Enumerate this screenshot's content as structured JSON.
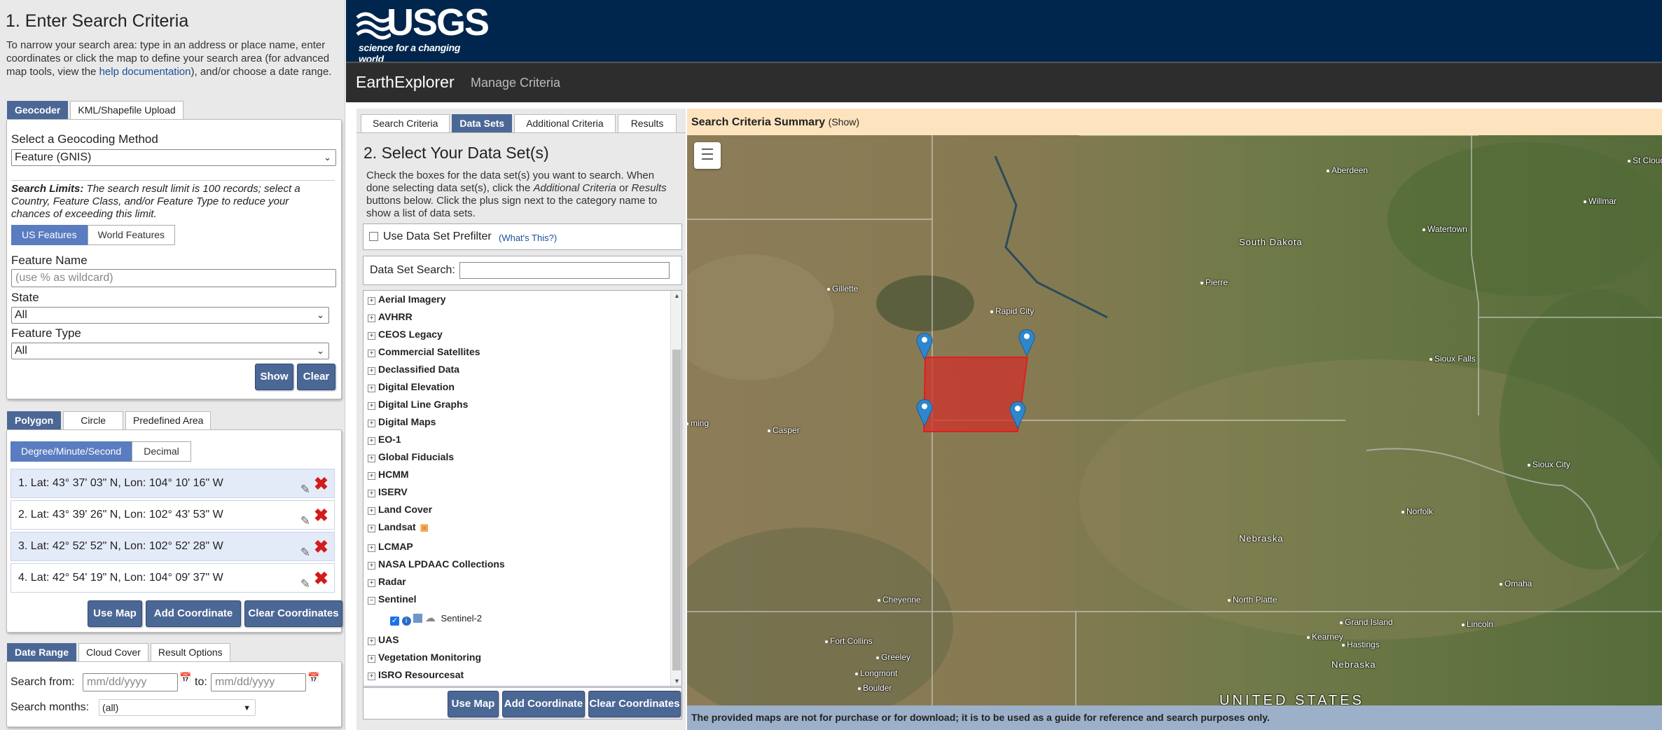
{
  "left": {
    "title": "1. Enter Search Criteria",
    "intro_pre": "To narrow your search area: type in an address or place name, enter coordinates or click the map to define your search area (for advanced map tools, view the ",
    "intro_link": "help documentation",
    "intro_post": "), and/or choose a date range.",
    "tabs": [
      "Geocoder",
      "KML/Shapefile Upload"
    ],
    "geocode_label": "Select a Geocoding Method",
    "geocode_value": "Feature (GNIS)",
    "limits_bold": "Search Limits:",
    "limits_text": " The search result limit is 100 records; select a Country, Feature Class, and/or Feature Type to reduce your chances of exceeding this limit.",
    "feature_toggle": [
      "US Features",
      "World Features"
    ],
    "feature_name_label": "Feature Name",
    "feature_name_placeholder": "(use % as wildcard)",
    "state_label": "State",
    "state_value": "All",
    "feature_type_label": "Feature Type",
    "feature_type_value": "All",
    "show_btn": "Show",
    "clear_btn": "Clear",
    "area_tabs": [
      "Polygon",
      "Circle",
      "Predefined Area"
    ],
    "format_toggle": [
      "Degree/Minute/Second",
      "Decimal"
    ],
    "coordinates": [
      "1.  Lat: 43° 37' 03\" N, Lon: 104° 10' 16\" W",
      "2.  Lat: 43° 39' 26\" N, Lon: 102° 43' 53\" W",
      "3.  Lat: 42° 52' 52\" N, Lon: 102° 52' 28\" W",
      "4.  Lat: 42° 54' 19\" N, Lon: 104° 09' 37\" W"
    ],
    "use_map_btn": "Use Map",
    "add_coord_btn": "Add Coordinate",
    "clear_coords_btn": "Clear Coordinates",
    "date_tabs": [
      "Date Range",
      "Cloud Cover",
      "Result Options"
    ],
    "search_from_label": "Search from:",
    "to_label": "to:",
    "date_placeholder": "mm/dd/yyyy",
    "months_label": "Search months:",
    "months_value": "(all)"
  },
  "header": {
    "logo_text": "USGS",
    "logo_tagline": "science for a changing world",
    "brand": "EarthExplorer",
    "manage": "Manage Criteria"
  },
  "middle": {
    "tabs": [
      "Search Criteria",
      "Data Sets",
      "Additional Criteria",
      "Results"
    ],
    "title": "2. Select Your Data Set(s)",
    "intro_a": "Check the boxes for the data set(s) you want to search. When done selecting data set(s), click the ",
    "intro_i1": "Additional Criteria",
    "intro_b": " or ",
    "intro_i2": "Results",
    "intro_c": " buttons below. Click the plus sign next to the category name to show a list of data sets.",
    "prefilter_label": "Use Data Set Prefilter",
    "whats_this": "(What's This?)",
    "search_label": "Data Set Search:",
    "categories": [
      "Aerial Imagery",
      "AVHRR",
      "CEOS Legacy",
      "Commercial Satellites",
      "Declassified Data",
      "Digital Elevation",
      "Digital Line Graphs",
      "Digital Maps",
      "EO-1",
      "Global Fiducials",
      "HCMM",
      "ISERV",
      "Land Cover",
      "Landsat",
      "LCMAP",
      "NASA LPDAAC Collections",
      "Radar",
      "Sentinel"
    ],
    "sentinel_child": "Sentinel-2",
    "categories_after": [
      "UAS",
      "Vegetation Monitoring",
      "ISRO Resourcesat"
    ],
    "use_map_btn": "Use Map",
    "add_coord_btn": "Add Coordinate",
    "clear_coords_btn": "Clear Coordinates"
  },
  "map": {
    "summary_title": "Search Criteria Summary",
    "summary_show": "(Show)",
    "footer": "The provided maps are not for purchase or for download; it is to be used as a guide for reference and search purposes only.",
    "cities": [
      "Aberdeen",
      "St Cloud",
      "Willmar",
      "Watertown",
      "South Dakota",
      "Pierre",
      "Gillette",
      "Rapid City",
      "Sioux Falls",
      "ming",
      "Casper",
      "Sioux City",
      "Norfolk",
      "Nebraska",
      "Omaha",
      "Cheyenne",
      "North Platte",
      "Grand Island",
      "Lincoln",
      "Kearney",
      "Hastings",
      "Nebraska",
      "Fort Collins",
      "Greeley",
      "Longmont",
      "Boulder",
      "UNITED STATES"
    ]
  }
}
